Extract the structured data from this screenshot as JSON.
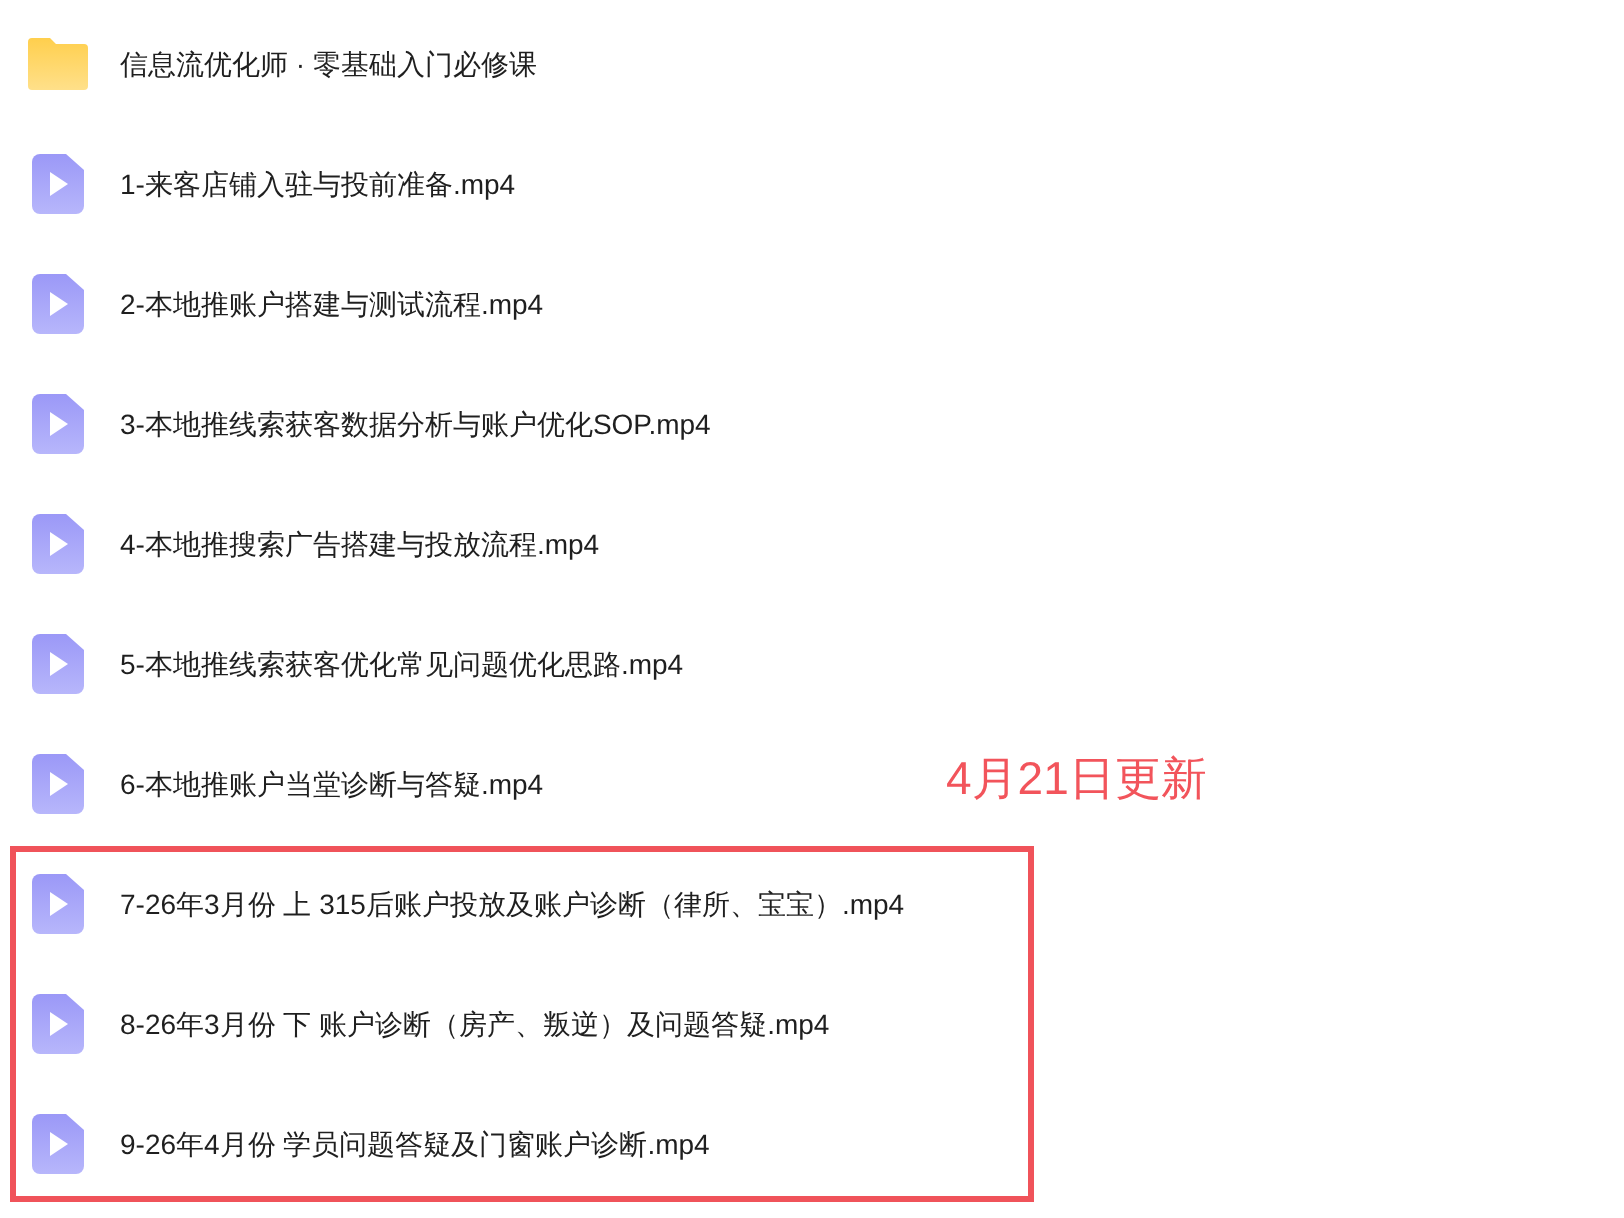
{
  "files": [
    {
      "kind": "folder",
      "name": "信息流优化师 · 零基础入门必修课",
      "highlighted": false
    },
    {
      "kind": "video",
      "name": "1-来客店铺入驻与投前准备.mp4",
      "highlighted": false
    },
    {
      "kind": "video",
      "name": "2-本地推账户搭建与测试流程.mp4",
      "highlighted": false
    },
    {
      "kind": "video",
      "name": "3-本地推线索获客数据分析与账户优化SOP.mp4",
      "highlighted": false
    },
    {
      "kind": "video",
      "name": "4-本地推搜索广告搭建与投放流程.mp4",
      "highlighted": false
    },
    {
      "kind": "video",
      "name": "5-本地推线索获客优化常见问题优化思路.mp4",
      "highlighted": false
    },
    {
      "kind": "video",
      "name": "6-本地推账户当堂诊断与答疑.mp4",
      "highlighted": false
    },
    {
      "kind": "video",
      "name": "7-26年3月份 上 315后账户投放及账户诊断（律所、宝宝）.mp4",
      "highlighted": true
    },
    {
      "kind": "video",
      "name": "8-26年3月份 下 账户诊断（房产、叛逆）及问题答疑.mp4",
      "highlighted": true
    },
    {
      "kind": "video",
      "name": "9-26年4月份 学员问题答疑及门窗账户诊断.mp4",
      "highlighted": true
    }
  ],
  "annotation": "4月21日更新"
}
